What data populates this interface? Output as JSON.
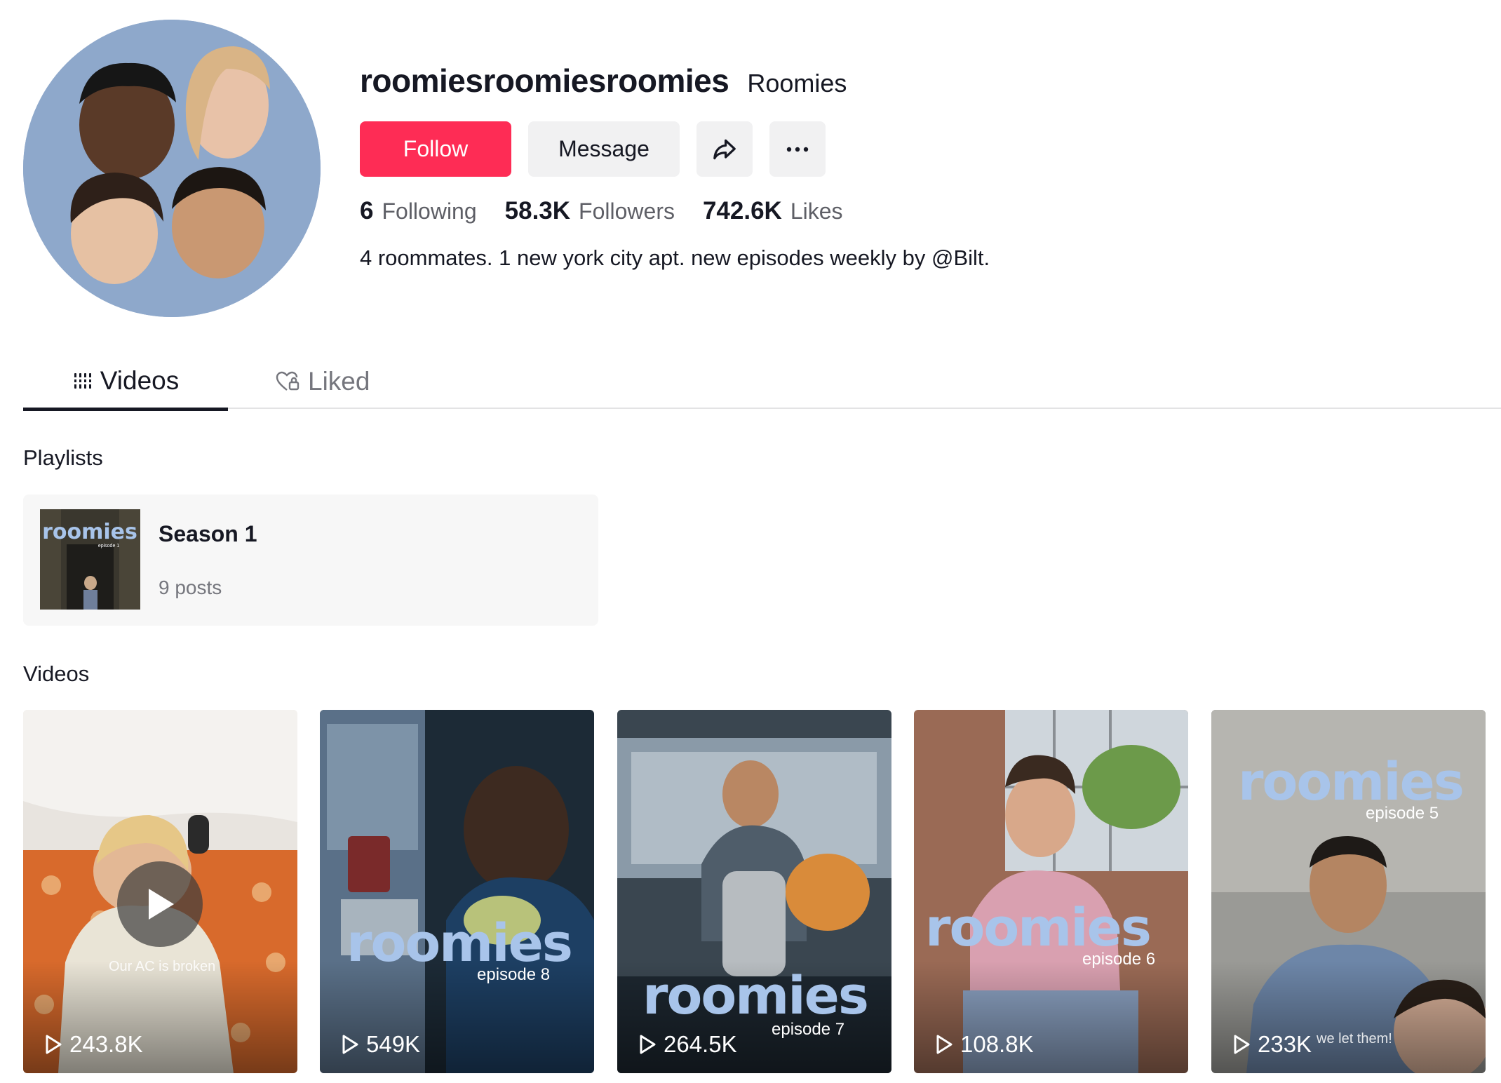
{
  "profile": {
    "username": "roomiesroomiesroomies",
    "nickname": "Roomies",
    "bio": "4 roommates. 1 new york city apt. new episodes weekly by @Bilt."
  },
  "actions": {
    "follow_label": "Follow",
    "message_label": "Message",
    "share_icon": "share-arrow-icon",
    "more_icon": "ellipsis-icon"
  },
  "stats": {
    "following_count": "6",
    "following_label": "Following",
    "followers_count": "58.3K",
    "followers_label": "Followers",
    "likes_count": "742.6K",
    "likes_label": "Likes"
  },
  "tabs": [
    {
      "label": "Videos",
      "icon": "grid-bars-icon",
      "active": true
    },
    {
      "label": "Liked",
      "icon": "heart-lock-icon",
      "active": false
    }
  ],
  "playlists": {
    "title": "Playlists",
    "items": [
      {
        "title": "Season 1",
        "count": "9 posts",
        "thumb_brand": "roomies",
        "thumb_episode": "episode 1"
      }
    ]
  },
  "videos": {
    "title": "Videos",
    "items": [
      {
        "views": "243.8K",
        "overlay": "Our AC is broken",
        "brand": "",
        "episode": ""
      },
      {
        "views": "549K",
        "overlay": "",
        "brand": "roomies",
        "episode": "episode 8"
      },
      {
        "views": "264.5K",
        "overlay": "",
        "brand": "roomies",
        "episode": "episode 7"
      },
      {
        "views": "108.8K",
        "overlay": "",
        "brand": "roomies",
        "episode": "episode 6"
      },
      {
        "views": "233K",
        "overlay": "we let them!",
        "brand": "roomies",
        "episode": "episode 5"
      }
    ]
  },
  "colors": {
    "accent": "#fe2c55",
    "brand_blue": "#a8c4ea",
    "avatar_bg": "#8ea8cb",
    "text_primary": "#161823",
    "text_secondary": "#75767d"
  }
}
